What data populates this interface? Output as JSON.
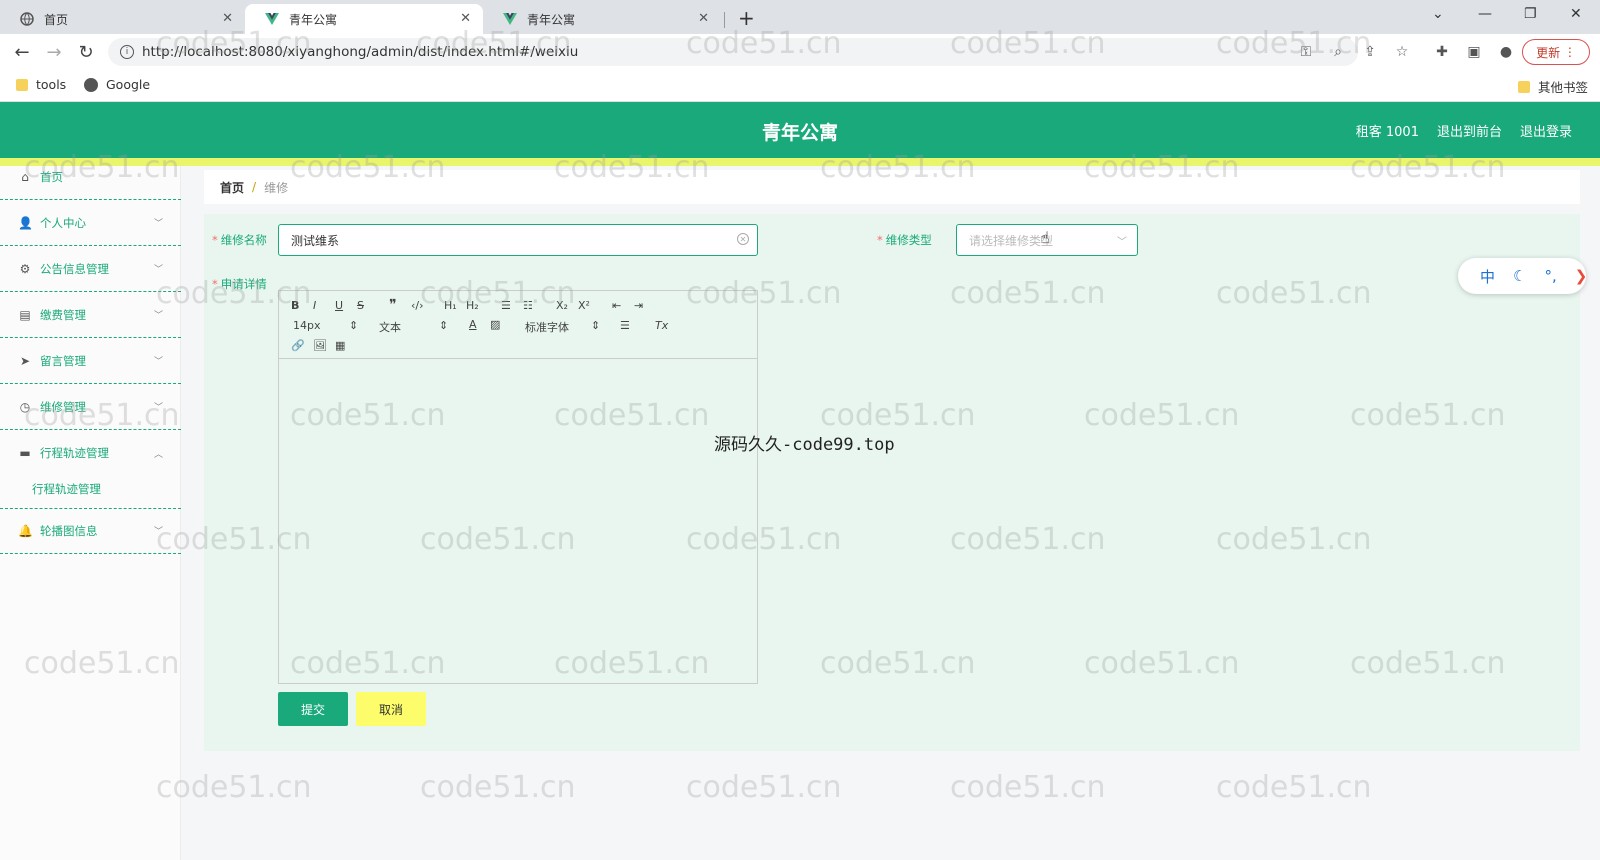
{
  "browser": {
    "tabs": [
      {
        "label": "首页"
      },
      {
        "label": "青年公寓"
      },
      {
        "label": "青年公寓"
      }
    ],
    "new_tab": "+",
    "url": "http://localhost:8080/xiyanghong/admin/dist/index.html#/weixiu",
    "update_label": "更新",
    "bookmarks": [
      {
        "label": "tools"
      },
      {
        "label": "Google"
      }
    ],
    "other_bookmarks": "其他书签"
  },
  "app": {
    "title": "青年公寓",
    "header_links": [
      "租客 1001",
      "退出到前台",
      "退出登录"
    ],
    "accent_color": "#1aa97a",
    "band_color": "#e9f56a"
  },
  "sidebar": {
    "items": [
      {
        "label": "首页",
        "icon": "home-icon"
      },
      {
        "label": "个人中心",
        "icon": "user-icon"
      },
      {
        "label": "公告信息管理",
        "icon": "settings-icon"
      },
      {
        "label": "缴费管理",
        "icon": "clipboard-icon"
      },
      {
        "label": "留言管理",
        "icon": "send-icon"
      },
      {
        "label": "维修管理",
        "icon": "clock-icon"
      },
      {
        "label": "行程轨迹管理",
        "icon": "document-icon"
      },
      {
        "label": "轮播图信息",
        "icon": "bell-icon"
      }
    ],
    "submenu": {
      "label": "行程轨迹管理"
    }
  },
  "breadcrumb": {
    "home": "首页",
    "separator": "/",
    "current": "维修"
  },
  "form": {
    "name_label": "维修名称",
    "name_value": "测试维系",
    "type_label": "维修类型",
    "type_placeholder": "请选择维修类型",
    "detail_label": "申请详情",
    "toolbar": {
      "font_size": "14px",
      "text_style": "文本",
      "font_family": "标准字体",
      "h1": "H₁",
      "h2": "H₂",
      "sub": "X₂",
      "sup": "X²"
    },
    "submit": "提交",
    "cancel": "取消"
  },
  "overlay_text": "源码久久-code99.top",
  "ime": {
    "lang": "中"
  },
  "watermark": "code51.cn"
}
